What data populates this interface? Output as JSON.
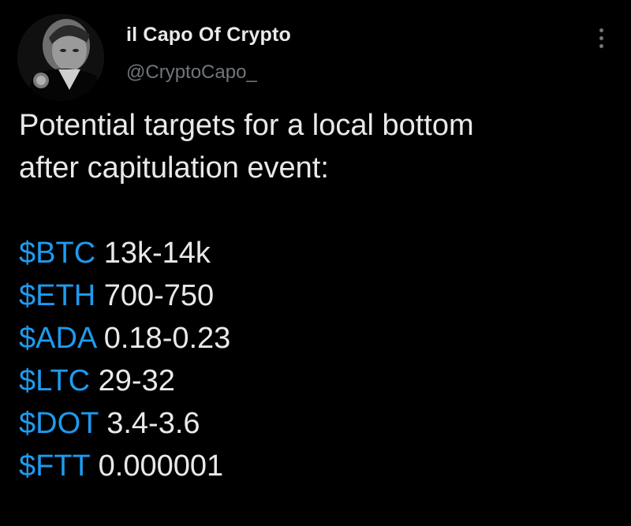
{
  "author": {
    "display_name": "il Capo Of Crypto",
    "handle": "@CryptoCapo_"
  },
  "tweet": {
    "intro_line_1": "Potential targets for a local bottom",
    "intro_line_2": "after capitulation event:",
    "targets": [
      {
        "tag": "$BTC",
        "range": " 13k-14k"
      },
      {
        "tag": "$ETH",
        "range": " 700-750"
      },
      {
        "tag": "$ADA",
        "range": " 0.18-0.23"
      },
      {
        "tag": "$LTC",
        "range": " 29-32"
      },
      {
        "tag": "$DOT",
        "range": " 3.4-3.6"
      },
      {
        "tag": "$FTT",
        "range": " 0.000001"
      }
    ]
  },
  "colors": {
    "background": "#000000",
    "text": "#e7e9ea",
    "secondary": "#71767b",
    "link": "#1d9bf0"
  },
  "icons": {
    "more": "more-vertical-icon"
  }
}
